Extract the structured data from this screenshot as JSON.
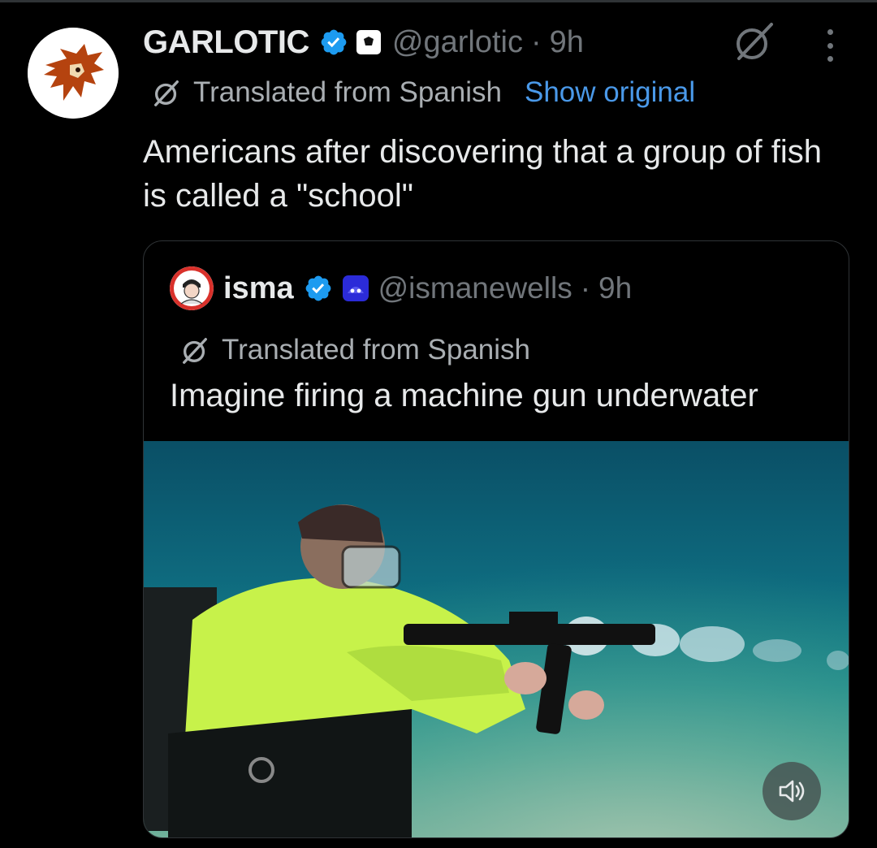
{
  "tweet": {
    "display_name": "GARLOTIC",
    "handle": "@garlotic",
    "separator": "·",
    "time": "9h",
    "translated_label": "Translated from Spanish",
    "show_original_label": "Show original",
    "text": "Americans after discovering that a group of fish is called a \"school\""
  },
  "quoted_tweet": {
    "display_name": "isma",
    "handle": "@ismanewells",
    "separator": "·",
    "time": "9h",
    "translated_label": "Translated from Spanish",
    "text": "Imagine firing a machine gun underwater"
  },
  "icons": {
    "verified": "verified-badge-icon",
    "affiliate": "affiliate-badge-icon",
    "grok": "grok-icon",
    "more": "more-options-icon",
    "translate": "translate-icon",
    "sound": "speaker-icon"
  },
  "colors": {
    "background": "#000000",
    "verified": "#1d9bf0",
    "link": "#4a99e9",
    "secondary_text": "#71767b",
    "primary_text": "#e7e9ea"
  }
}
